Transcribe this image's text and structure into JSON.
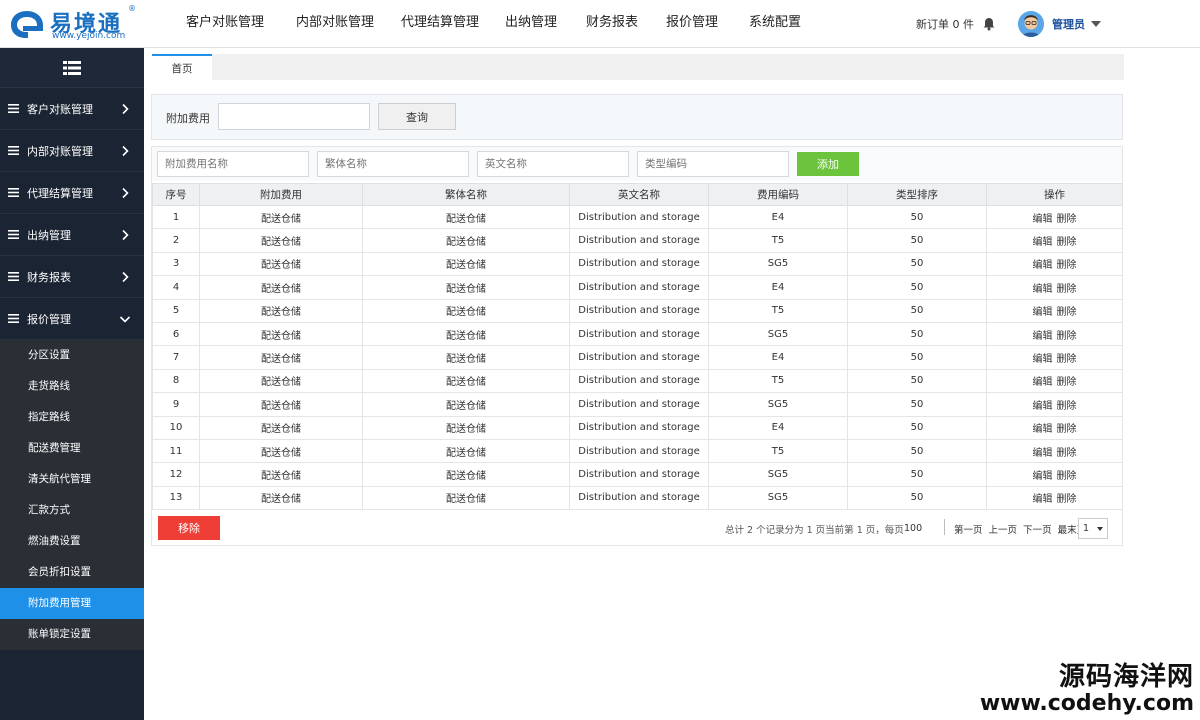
{
  "brand": {
    "name_cn": "易境通",
    "url": "www.yejoin.com",
    "reg": "®"
  },
  "topnav": [
    {
      "label": "客户对账管理"
    },
    {
      "label": "内部对账管理"
    },
    {
      "label": "代理结算管理"
    },
    {
      "label": "出纳管理"
    },
    {
      "label": "财务报表"
    },
    {
      "label": "报价管理"
    },
    {
      "label": "系统配置"
    }
  ],
  "header": {
    "orders": "新订单 0 件",
    "user": "管理员"
  },
  "sidebar": {
    "items": [
      {
        "label": "客户对账管理"
      },
      {
        "label": "内部对账管理"
      },
      {
        "label": "代理结算管理"
      },
      {
        "label": "出纳管理"
      },
      {
        "label": "财务报表"
      },
      {
        "label": "报价管理"
      }
    ],
    "subitems": [
      {
        "label": "分区设置"
      },
      {
        "label": "走货路线"
      },
      {
        "label": "指定路线"
      },
      {
        "label": "配送费管理"
      },
      {
        "label": "清关航代管理"
      },
      {
        "label": "汇款方式"
      },
      {
        "label": "燃油费设置"
      },
      {
        "label": "会员折扣设置"
      },
      {
        "label": "附加费用管理"
      },
      {
        "label": "账单锁定设置"
      }
    ]
  },
  "tabs": [
    {
      "label": "首页"
    }
  ],
  "search": {
    "label": "附加费用",
    "value": "",
    "button": "查询"
  },
  "add_form": {
    "name_placeholder": "附加费用名称",
    "trad_placeholder": "繁体名称",
    "en_placeholder": "英文名称",
    "type_placeholder": "类型编码",
    "button": "添加"
  },
  "table": {
    "columns": [
      "序号",
      "附加费用",
      "繁体名称",
      "英文名称",
      "费用编码",
      "类型排序",
      "操作"
    ],
    "edit_label": "编辑",
    "delete_label": "删除",
    "rows": [
      [
        "1",
        "配送仓储",
        "配送仓储",
        "Distribution and storage",
        "E4",
        "50"
      ],
      [
        "2",
        "配送仓储",
        "配送仓储",
        "Distribution and storage",
        "T5",
        "50"
      ],
      [
        "3",
        "配送仓储",
        "配送仓储",
        "Distribution and storage",
        "SG5",
        "50"
      ],
      [
        "4",
        "配送仓储",
        "配送仓储",
        "Distribution and storage",
        "E4",
        "50"
      ],
      [
        "5",
        "配送仓储",
        "配送仓储",
        "Distribution and storage",
        "T5",
        "50"
      ],
      [
        "6",
        "配送仓储",
        "配送仓储",
        "Distribution and storage",
        "SG5",
        "50"
      ],
      [
        "7",
        "配送仓储",
        "配送仓储",
        "Distribution and storage",
        "E4",
        "50"
      ],
      [
        "8",
        "配送仓储",
        "配送仓储",
        "Distribution and storage",
        "T5",
        "50"
      ],
      [
        "9",
        "配送仓储",
        "配送仓储",
        "Distribution and storage",
        "SG5",
        "50"
      ],
      [
        "10",
        "配送仓储",
        "配送仓储",
        "Distribution and storage",
        "E4",
        "50"
      ],
      [
        "11",
        "配送仓储",
        "配送仓储",
        "Distribution and storage",
        "T5",
        "50"
      ],
      [
        "12",
        "配送仓储",
        "配送仓储",
        "Distribution and storage",
        "SG5",
        "50"
      ],
      [
        "13",
        "配送仓储",
        "配送仓储",
        "Distribution and storage",
        "SG5",
        "50"
      ]
    ]
  },
  "footer": {
    "delete_button": "移除",
    "info": "总计 2 个记录分为 1 页当前第 1 页，每页",
    "page_size": "100",
    "first": "第一页",
    "prev": "上一页",
    "next": "下一页",
    "last": "最末页",
    "current_page": "1"
  },
  "watermark": {
    "cn": "源码海洋网",
    "url": "www.codehy.com"
  },
  "colors": {
    "sidebar_bg": "#1b2433",
    "active_blue": "#1e90e8",
    "add_green": "#6cc43c",
    "delete_red": "#ef3e36",
    "brand_blue": "#1a6fc0"
  }
}
